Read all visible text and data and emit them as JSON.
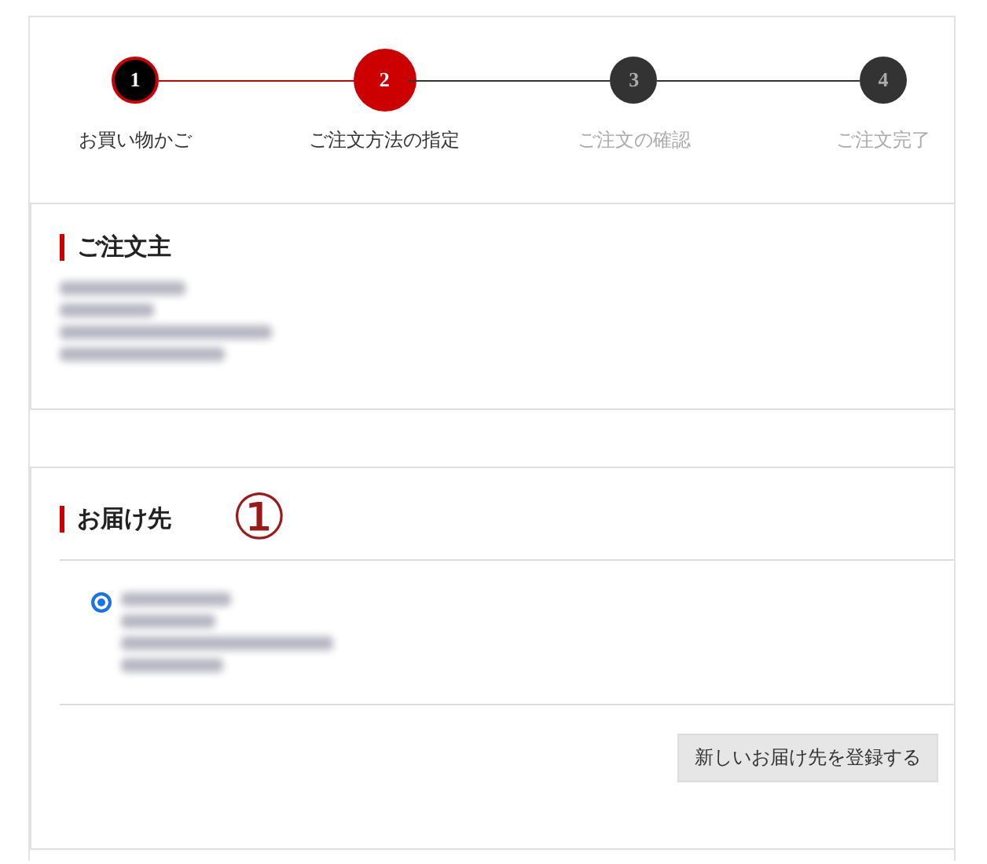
{
  "steps": [
    {
      "number": "1",
      "label": "お買い物かご",
      "kind": "done"
    },
    {
      "number": "2",
      "label": "ご注文方法の指定",
      "kind": "current"
    },
    {
      "number": "3",
      "label": "ご注文の確認",
      "kind": "upcoming"
    },
    {
      "number": "4",
      "label": "ご注文完了",
      "kind": "upcoming"
    }
  ],
  "orderer": {
    "heading": "ご注文主"
  },
  "delivery": {
    "heading": "お届け先",
    "annotation": "①",
    "addresses": [
      {
        "selected": true
      }
    ],
    "new_address_button": "新しいお届け先を登録する"
  }
}
